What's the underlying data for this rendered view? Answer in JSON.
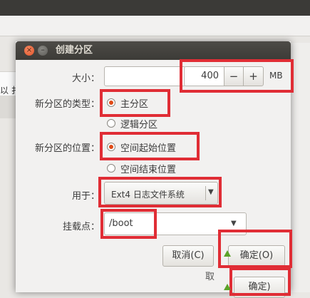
{
  "window": {
    "title": "创建分区"
  },
  "background": {
    "clipped_text": "以 扌"
  },
  "size": {
    "label": "大小：",
    "value": "400",
    "minus": "−",
    "plus": "+",
    "unit": "MB"
  },
  "type": {
    "label": "新分区的类型：",
    "options": [
      {
        "label": "主分区",
        "selected": true
      },
      {
        "label": "逻辑分区",
        "selected": false
      }
    ]
  },
  "location": {
    "label": "新分区的位置：",
    "options": [
      {
        "label": "空间起始位置",
        "selected": true
      },
      {
        "label": "空间结束位置",
        "selected": false
      }
    ]
  },
  "use_as": {
    "label": "用于：",
    "value": "Ext4 日志文件系统"
  },
  "mount": {
    "label": "挂载点：",
    "value": "/boot"
  },
  "buttons": {
    "cancel": "取消(C)",
    "ok": "确定(O)",
    "ok_behind": "确定)",
    "cancel_behind": "取"
  },
  "colors": {
    "highlight": "#e02d35",
    "radio_selected": "#df4a16",
    "titlebar": "#3c3b37"
  }
}
